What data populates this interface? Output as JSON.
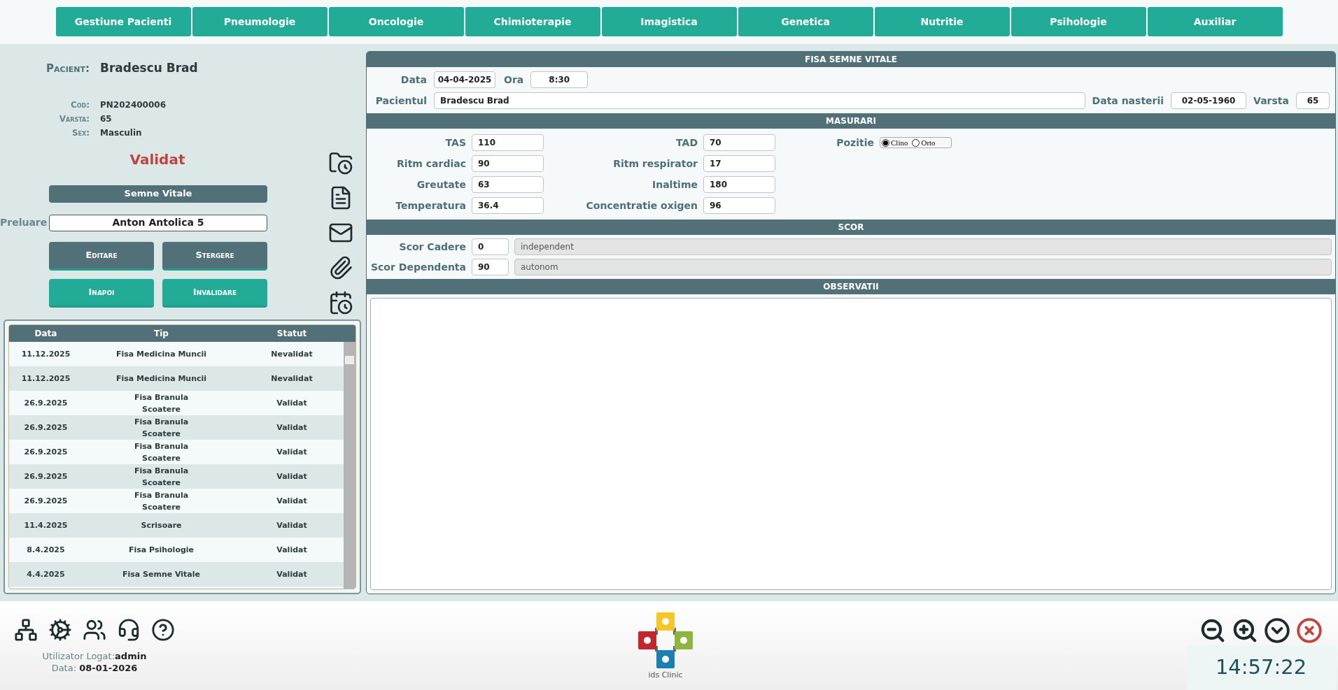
{
  "nav_tabs": [
    {
      "label": "Gestiune Pacienti"
    },
    {
      "label": "Pneumologie"
    },
    {
      "label": "Oncologie"
    },
    {
      "label": "Chimioterapie"
    },
    {
      "label": "Imagistica"
    },
    {
      "label": "Genetica"
    },
    {
      "label": "Nutritie"
    },
    {
      "label": "Psihologie"
    },
    {
      "label": "Auxiliar"
    }
  ],
  "patient": {
    "label": "Pacient:",
    "name": "Bradescu Brad",
    "details": [
      {
        "label": "Cod:",
        "value": "PN202400006"
      },
      {
        "label": "Varsta:",
        "value": "65"
      },
      {
        "label": "Sex:",
        "value": "Masculin"
      }
    ],
    "status": "Validat"
  },
  "section_button": "Semne Vitale",
  "preluare": {
    "label": "Preluare",
    "value": "Anton Antolica 5"
  },
  "actions": [
    {
      "label": "Editare",
      "kind": "secondary"
    },
    {
      "label": "Stergere",
      "kind": "secondary"
    },
    {
      "label": "Inapoi",
      "kind": "primary"
    },
    {
      "label": "Invalidare",
      "kind": "primary"
    }
  ],
  "history": {
    "columns": [
      "Data",
      "Tip",
      "Statut"
    ],
    "rows": [
      [
        "11.12.2025",
        "Fisa Medicina Muncii",
        "Nevalidat"
      ],
      [
        "11.12.2025",
        "Fisa Medicina Muncii",
        "Nevalidat"
      ],
      [
        "26.9.2025",
        "Fisa Branula\nScoatere",
        "Validat"
      ],
      [
        "26.9.2025",
        "Fisa Branula\nScoatere",
        "Validat"
      ],
      [
        "26.9.2025",
        "Fisa Branula\nScoatere",
        "Validat"
      ],
      [
        "26.9.2025",
        "Fisa Branula\nScoatere",
        "Validat"
      ],
      [
        "26.9.2025",
        "Fisa Branula\nScoatere",
        "Validat"
      ],
      [
        "11.4.2025",
        "Scrisoare",
        "Validat"
      ],
      [
        "8.4.2025",
        "Fisa Psihologie",
        "Validat"
      ],
      [
        "4.4.2025",
        "Fisa Semne Vitale",
        "Validat"
      ]
    ]
  },
  "form": {
    "title": "FISA SEMNE VITALE",
    "date": {
      "label": "Data",
      "value": "04-04-2025"
    },
    "time": {
      "label": "Ora",
      "value": "8:30"
    },
    "patient": {
      "label": "Pacientul",
      "value": "Bradescu Brad"
    },
    "birth_date": {
      "label": "Data nasterii",
      "value": "02-05-1960"
    },
    "age": {
      "label": "Varsta",
      "value": "65"
    },
    "measurements": {
      "title": "MASURARI",
      "rows": [
        {
          "left": {
            "label": "TAS",
            "value": "110"
          },
          "right": {
            "label": "TAD",
            "value": "70"
          }
        },
        {
          "left": {
            "label": "Ritm cardiac",
            "value": "90"
          },
          "right": {
            "label": "Ritm respirator",
            "value": "17"
          }
        },
        {
          "left": {
            "label": "Greutate",
            "value": "63"
          },
          "right": {
            "label": "Inaltime",
            "value": "180"
          }
        },
        {
          "left": {
            "label": "Temperatura",
            "value": "36.4"
          },
          "right": {
            "label": "Concentratie oxigen",
            "value": "96"
          }
        }
      ],
      "position": {
        "label": "Pozitie",
        "options": [
          {
            "label": "Clino",
            "selected": true
          },
          {
            "label": "Orto",
            "selected": false
          }
        ]
      }
    },
    "score": {
      "title": "SCOR",
      "rows": [
        {
          "label": "Scor Cadere",
          "value": "0",
          "description": "independent"
        },
        {
          "label": "Scor Dependenta",
          "value": "90",
          "description": "autonom"
        }
      ]
    },
    "observations": {
      "title": "OBSERVATII"
    }
  },
  "footer": {
    "user_label": "Utilizator Logat:",
    "user": "admin",
    "date_label": "Data:",
    "date": "08-01-2026",
    "logo_text": "ids Clinic",
    "clock": "14:57:22"
  }
}
